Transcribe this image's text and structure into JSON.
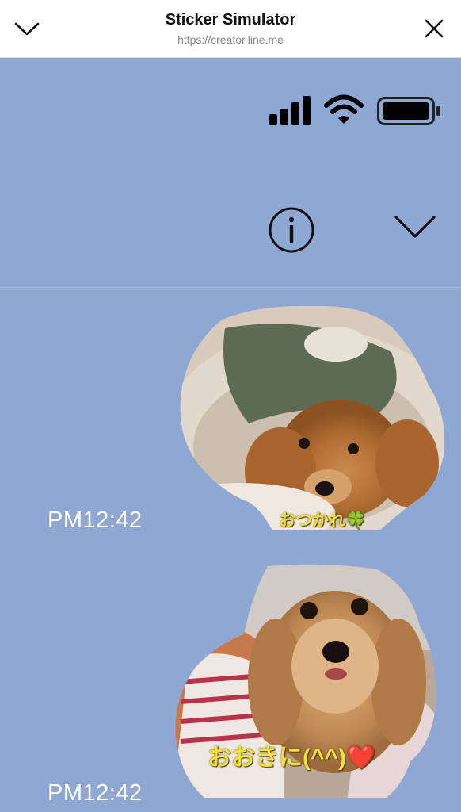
{
  "header": {
    "title": "Sticker Simulator",
    "url": "https://creator.line.me",
    "collapse_icon": "chevron-down-icon",
    "close_icon": "close-icon"
  },
  "status_bar": {
    "signal_icon": "signal-icon",
    "wifi_icon": "wifi-icon",
    "battery_icon": "battery-icon"
  },
  "toolbar": {
    "info_icon": "info-icon",
    "collapse_icon": "chevron-down-icon"
  },
  "messages": [
    {
      "time": "PM12:42",
      "caption": "おつかれ🍀"
    },
    {
      "time": "PM12:42",
      "caption": "おおきに(^^)❤️"
    }
  ],
  "colors": {
    "chat_background": "#8fa7d3",
    "caption": "#f4e03a"
  }
}
